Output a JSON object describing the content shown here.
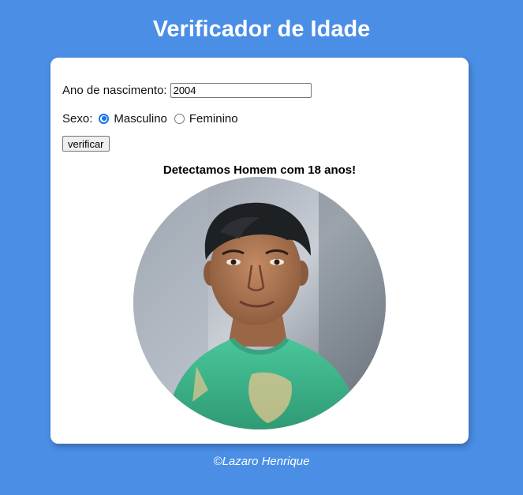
{
  "header": {
    "title": "Verificador de Idade"
  },
  "form": {
    "year_label": "Ano de nascimento:",
    "year_value": "2004",
    "sex_label": "Sexo:",
    "options": [
      {
        "label": "Masculino",
        "checked": true
      },
      {
        "label": "Feminino",
        "checked": false
      }
    ],
    "verify_label": "verificar"
  },
  "result": {
    "text": "Detectamos Homem com 18 anos!",
    "image_icon": "person-photo"
  },
  "footer": {
    "text": "©Lazaro Henrique"
  },
  "colors": {
    "background": "#4a8ee6",
    "card": "#ffffff",
    "radio_accent": "#1a73e8"
  }
}
